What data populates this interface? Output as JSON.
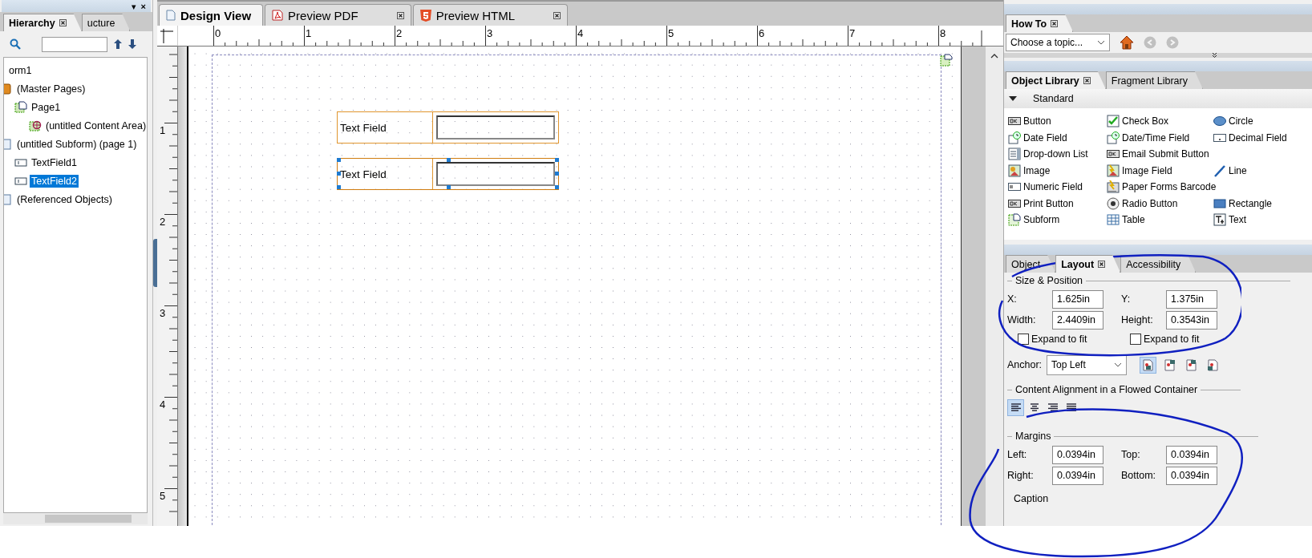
{
  "hierarchy_panel": {
    "controls": [
      "▾",
      "×"
    ],
    "tabs": [
      {
        "label": "Hierarchy",
        "selected": true,
        "closable": true
      },
      {
        "label": "ucture",
        "selected": false,
        "closable": false
      }
    ],
    "tree": [
      {
        "label": "orm1",
        "selected": false,
        "children": [
          {
            "label": "(Master Pages)",
            "kind": "master",
            "selected": false,
            "children": [
              {
                "label": "Page1",
                "kind": "page",
                "selected": false,
                "children": [
                  {
                    "label": "(untitled Content Area)",
                    "kind": "content-area",
                    "selected": false
                  }
                ]
              }
            ]
          },
          {
            "label": "(untitled Subform) (page 1)",
            "kind": "subform",
            "selected": false,
            "children": [
              {
                "label": "TextField1",
                "kind": "text-field",
                "selected": false
              },
              {
                "label": "TextField2",
                "kind": "text-field",
                "selected": true
              }
            ]
          },
          {
            "label": "(Referenced Objects)",
            "kind": "referenced",
            "selected": false
          }
        ]
      }
    ]
  },
  "editor": {
    "tabs": [
      {
        "label": "Design View",
        "kind": "page",
        "selected": true,
        "closable": false
      },
      {
        "label": "Preview PDF",
        "kind": "pdf",
        "selected": false,
        "closable": true
      },
      {
        "label": "Preview HTML",
        "kind": "html",
        "selected": false,
        "closable": true
      }
    ],
    "ruler": {
      "horizontal": [
        "0",
        "1",
        "2",
        "3",
        "4",
        "5",
        "6",
        "7",
        "8"
      ],
      "vertical": [
        "1",
        "2",
        "3",
        "4",
        "5"
      ]
    },
    "form_fields": [
      {
        "caption": "Text Field",
        "selected": false
      },
      {
        "caption": "Text Field",
        "selected": true
      }
    ]
  },
  "how_to": {
    "tabs": [
      {
        "label": "How To",
        "selected": true,
        "closable": true
      }
    ],
    "topic": {
      "value": "Choose a topic..."
    }
  },
  "object_library": {
    "tabs": [
      {
        "label": "Object Library",
        "selected": true,
        "closable": true
      },
      {
        "label": "Fragment Library",
        "selected": false,
        "closable": false
      }
    ],
    "group": {
      "label": "Standard",
      "expanded": true
    },
    "rows": [
      [
        {
          "label": "Button",
          "kind": "ok"
        },
        {
          "label": "Check Box",
          "kind": "check"
        },
        {
          "label": "Circle",
          "kind": "circle"
        }
      ],
      [
        {
          "label": "Date Field",
          "kind": "clock"
        },
        {
          "label": "Date/Time Field",
          "kind": "clock"
        },
        {
          "label": "Decimal Field",
          "kind": "decimal"
        }
      ],
      [
        {
          "label": "Drop-down List",
          "kind": "dropdown"
        },
        {
          "label": "Email Submit Button",
          "kind": "ok"
        }
      ],
      [
        {
          "label": "Image",
          "kind": "image"
        },
        {
          "label": "Image Field",
          "kind": "image-field"
        },
        {
          "label": "Line",
          "kind": "line"
        }
      ],
      [
        {
          "label": "Numeric Field",
          "kind": "numeric"
        },
        {
          "label": "Paper Forms Barcode",
          "kind": "barcode"
        }
      ],
      [
        {
          "label": "Print Button",
          "kind": "ok"
        },
        {
          "label": "Radio Button",
          "kind": "radio"
        },
        {
          "label": "Rectangle",
          "kind": "rect"
        }
      ],
      [
        {
          "label": "Subform",
          "kind": "subform"
        },
        {
          "label": "Table",
          "kind": "table"
        },
        {
          "label": "Text",
          "kind": "text"
        }
      ]
    ]
  },
  "properties": {
    "tabs": [
      {
        "label": "Object",
        "selected": false,
        "closable": false
      },
      {
        "label": "Layout",
        "selected": true,
        "closable": true
      },
      {
        "label": "Accessibility",
        "selected": false,
        "closable": false
      }
    ],
    "size_position": {
      "title": "Size & Position",
      "rows": [
        [
          {
            "label": "X:",
            "value": "1.625in"
          },
          {
            "label": "Y:",
            "value": "1.375in"
          }
        ],
        [
          {
            "label": "Width:",
            "value": "2.4409in"
          },
          {
            "label": "Height:",
            "value": "0.3543in"
          }
        ]
      ],
      "checks": [
        {
          "label": "Expand to fit",
          "checked": false
        },
        {
          "label": "Expand to fit",
          "checked": false
        }
      ]
    },
    "anchor": {
      "label": "Anchor:",
      "value": "Top Left",
      "buttons": [
        {
          "selected": true
        },
        {
          "selected": false
        },
        {
          "selected": false
        },
        {
          "selected": false
        }
      ]
    },
    "alignment": {
      "title": "Content Alignment in a Flowed Container",
      "buttons": [
        {
          "kind": "left",
          "selected": true
        },
        {
          "kind": "center",
          "selected": false
        },
        {
          "kind": "right",
          "selected": false
        },
        {
          "kind": "justify",
          "selected": false
        }
      ]
    },
    "margins": {
      "title": "Margins",
      "rows": [
        [
          {
            "label": "Left:",
            "value": "0.0394in"
          },
          {
            "label": "Top:",
            "value": "0.0394in"
          }
        ],
        [
          {
            "label": "Right:",
            "value": "0.0394in"
          },
          {
            "label": "Bottom:",
            "value": "0.0394in"
          }
        ]
      ]
    },
    "next_section": "Caption"
  }
}
